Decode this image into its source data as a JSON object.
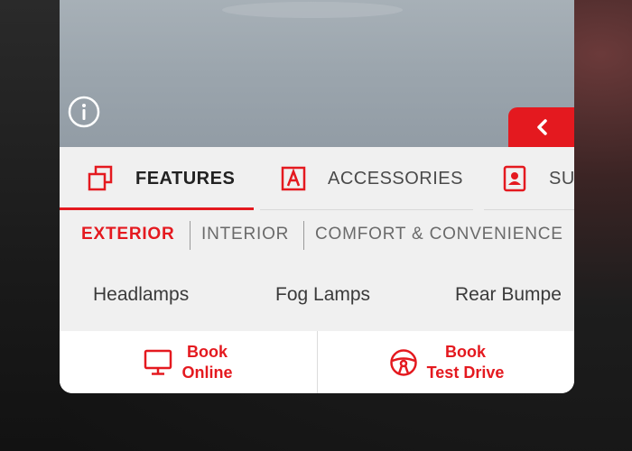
{
  "tabs": {
    "features": "FEATURES",
    "accessories": "ACCESSORIES",
    "sub_partial": "SU"
  },
  "subtabs": {
    "exterior": "EXTERIOR",
    "interior": "INTERIOR",
    "comfort": "COMFORT & CONVENIENCE"
  },
  "features": [
    "Headlamps",
    "Fog Lamps",
    "Rear Bumpe"
  ],
  "cta": {
    "online_line1": "Book",
    "online_line2": "Online",
    "drive_line1": "Book",
    "drive_line2": "Test Drive"
  },
  "colors": {
    "accent": "#e4191f",
    "text": "#3a3a3a"
  },
  "icons": {
    "info": "info-icon",
    "collapse": "chevron-left-icon",
    "features": "features-copy-icon",
    "accessories": "accessories-a-icon",
    "sub": "book-person-icon",
    "online": "monitor-icon",
    "drive": "steering-wheel-icon"
  }
}
